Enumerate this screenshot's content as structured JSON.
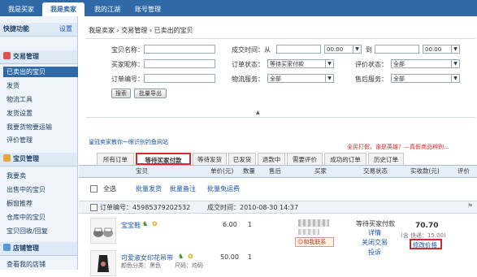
{
  "topnav": {
    "tabs": [
      "我是买家",
      "我是卖家",
      "我的江湖",
      "账号管理"
    ]
  },
  "sidebar": {
    "quick": {
      "title": "快捷功能",
      "action": "设置"
    },
    "sections": [
      {
        "title": "交易管理",
        "color": "#d9534f",
        "items": [
          "已卖出的宝贝",
          "发货",
          "物流工具",
          "发货设置",
          "我要货物要运输",
          "评价管理"
        ]
      },
      {
        "title": "宝贝管理",
        "color": "#e8a33a",
        "items": [
          "我要卖",
          "出售中的宝贝",
          "橱窗推荐",
          "仓库中的宝贝",
          "宝贝回收/回复"
        ]
      },
      {
        "title": "店铺管理",
        "color": "#5b9bd5",
        "items": [
          "查看我的店铺"
        ]
      }
    ]
  },
  "breadcrumb": "我是卖家 › 交易管理 › 已卖出的宝贝",
  "search": {
    "item_name_label": "宝贝名称：",
    "buyer_label": "买家昵称：",
    "order_no_label": "订单编号：",
    "time_label": "成交时间：从",
    "time_hour1": "00:00",
    "to_label": "到",
    "time_hour2": "00:00",
    "status_label": "订单状态：",
    "status_value": "等待买家付款",
    "logistics_label": "物流服务：",
    "logistics_value": "全部",
    "rating_label": "评价状态：",
    "rating_value": "全部",
    "aftersale_label": "售后服务：",
    "aftersale_value": "全部",
    "search_btn": "搜索",
    "export_btn": "批量导出"
  },
  "collapse_arrow": "▲",
  "promo_link": "皇冠卖家教你一眼识别钓鱼网站",
  "promo_right": "全民打假，谁是英雄？—真假商品辨别...",
  "order_tabs": [
    "所有订单",
    "等待买家付款",
    "等待发货",
    "已发货",
    "退款中",
    "需要评价",
    "成功的订单",
    "历史订单"
  ],
  "table_headers": [
    "宝贝",
    "单价(元)",
    "数量",
    "售后",
    "买家",
    "交易状态",
    "实收款(元)",
    "评价"
  ],
  "batch": {
    "select_all": "全选",
    "batch_ship": "批量发货",
    "batch_note": "批量备注",
    "batch_free": "批量免运费"
  },
  "order": {
    "order_no": "订单编号：45985379202532",
    "time": "成交时间：2010-08-30 14:37",
    "items": [
      {
        "name": "宝宝鞋",
        "price": "6.00",
        "qty": "1"
      },
      {
        "name": "可爱淑女印花吊带",
        "sub1": "颜色分类：黑色",
        "sub2": "尺码：均码",
        "price": "50.00",
        "qty": "1"
      }
    ],
    "buyer_contact": "和我联系",
    "status": "等待买家付款",
    "detail": "详情",
    "close": "关闭交易",
    "complaint": "投诉",
    "total": "70.70",
    "shipping": "(含 快递：15.00)",
    "modify_price": "修改价格"
  }
}
